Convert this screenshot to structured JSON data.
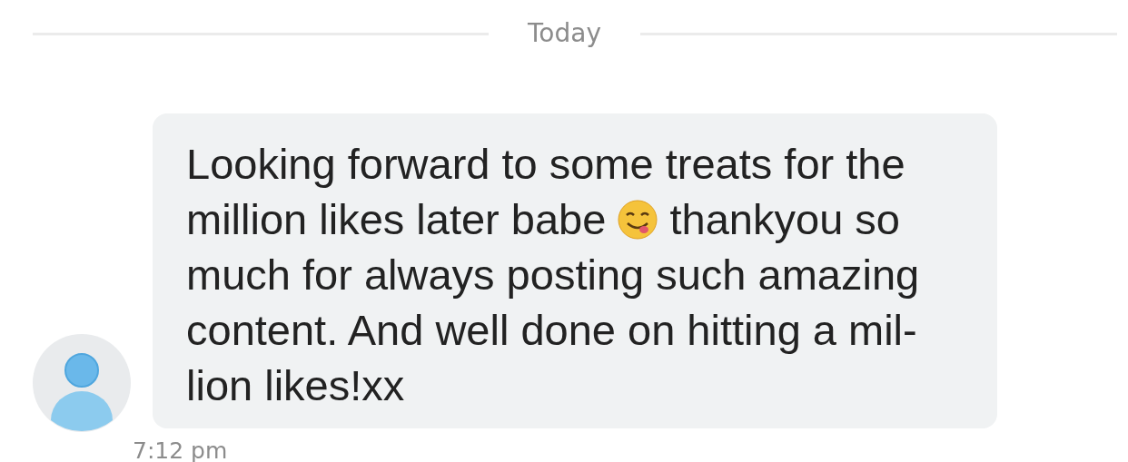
{
  "divider": {
    "label": "Today"
  },
  "message": {
    "lines": [
      {
        "text": "Looking forward to some treats for the"
      },
      {
        "text": "million likes later babe",
        "emoji_after": true,
        "text_after": "thankyou so"
      },
      {
        "text": "much for always posting such amazing"
      },
      {
        "text": "content. And well done on hitting a mil-"
      },
      {
        "text": "lion likes!xx"
      }
    ],
    "time": "7:12 pm"
  }
}
